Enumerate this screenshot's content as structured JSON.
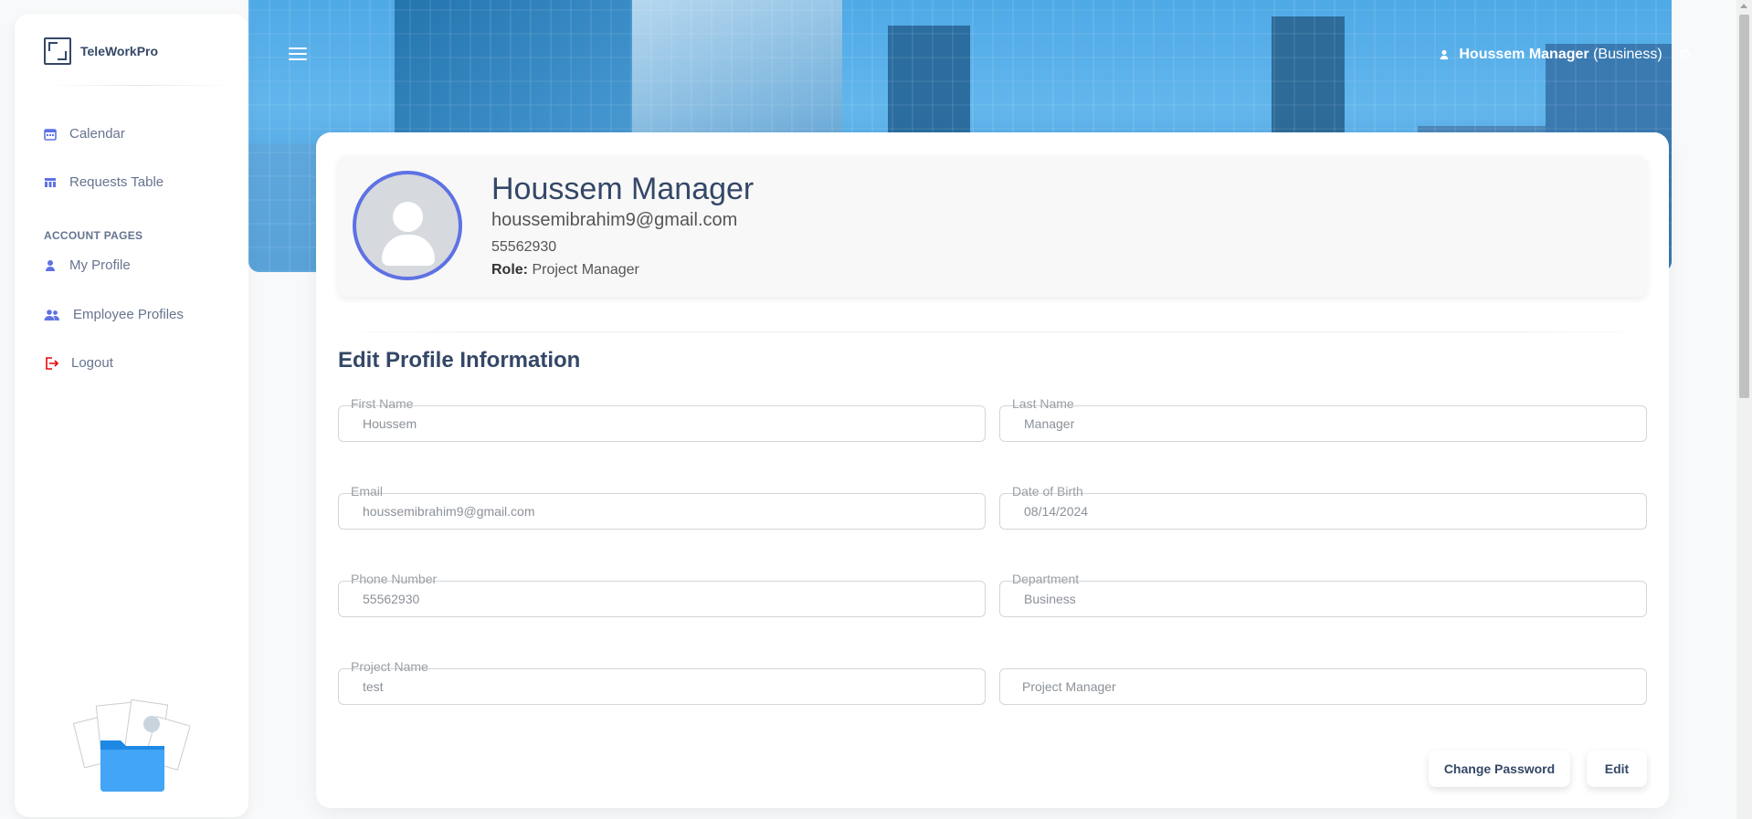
{
  "app": {
    "name": "TeleWorkPro"
  },
  "sidebar": {
    "items": [
      {
        "label": "Calendar",
        "icon": "calendar-icon"
      },
      {
        "label": "Requests Table",
        "icon": "table-icon"
      }
    ],
    "section_title": "ACCOUNT PAGES",
    "account_items": [
      {
        "label": "My Profile",
        "icon": "user-icon"
      },
      {
        "label": "Employee Profiles",
        "icon": "users-icon"
      },
      {
        "label": "Logout",
        "icon": "logout-icon"
      }
    ]
  },
  "header": {
    "user_name": "Houssem Manager",
    "user_dept": "(Business)"
  },
  "profile": {
    "name": "Houssem Manager",
    "email": "houssemibrahim9@gmail.com",
    "phone": "55562930",
    "role_label": "Role:",
    "role": "Project Manager"
  },
  "form": {
    "title": "Edit Profile Information",
    "first_name": {
      "label": "First Name",
      "value": "Houssem"
    },
    "last_name": {
      "label": "Last Name",
      "value": "Manager"
    },
    "email": {
      "label": "Email",
      "value": "houssemibrahim9@gmail.com"
    },
    "dob": {
      "label": "Date of Birth",
      "value": "08/14/2024"
    },
    "phone": {
      "label": "Phone Number",
      "value": "55562930"
    },
    "department": {
      "label": "Department",
      "value": "Business"
    },
    "project_name": {
      "label": "Project Name",
      "value": "test"
    },
    "role_field": {
      "value": "Project Manager"
    },
    "change_password_label": "Change Password",
    "edit_label": "Edit"
  },
  "colors": {
    "accent": "#5e72e4",
    "logout": "#ea0606",
    "text": "#344767"
  }
}
